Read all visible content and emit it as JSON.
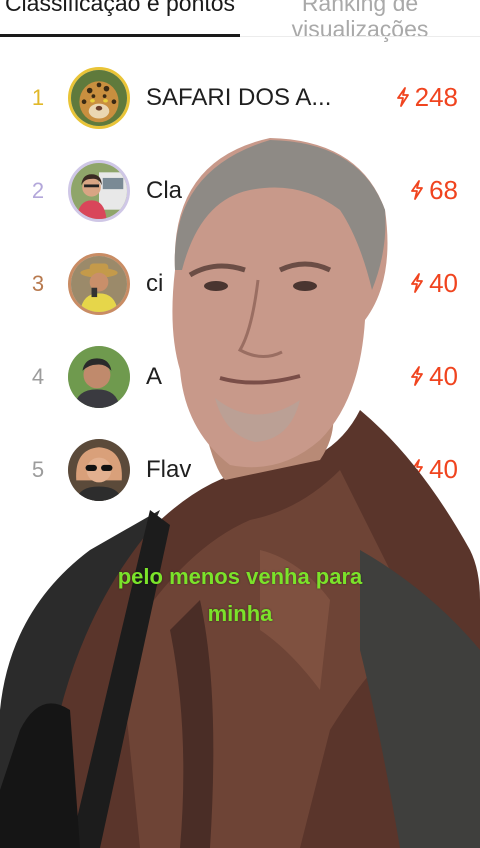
{
  "tabs": {
    "active": "Classificação e pontos",
    "inactive": "Ranking de visualizações"
  },
  "ranking": [
    {
      "rank": "1",
      "name": "SAFARI DOS A...",
      "score": "248",
      "rank_color": "#e1b829",
      "avatar_icon": "jaguar-avatar"
    },
    {
      "rank": "2",
      "name": "Cla",
      "score": "68",
      "rank_color": "#b3a7da",
      "avatar_icon": "woman-car-avatar"
    },
    {
      "rank": "3",
      "name": "ci",
      "score": "40",
      "rank_color": "#b87a4f",
      "avatar_icon": "man-hat-avatar"
    },
    {
      "rank": "4",
      "name": "A",
      "score": "40",
      "rank_color": "#9c9c9c",
      "avatar_icon": "man-avatar"
    },
    {
      "rank": "5",
      "name": "Flav",
      "score": "40",
      "rank_color": "#9c9c9c",
      "avatar_icon": "woman-sunglasses-avatar"
    }
  ],
  "caption": {
    "line1": "pelo menos venha para",
    "line2": "minha"
  },
  "colors": {
    "score": "#f0441f",
    "caption": "#7be32a",
    "active_tab": "#1a1a1a",
    "inactive_tab": "#a9a9a9"
  }
}
